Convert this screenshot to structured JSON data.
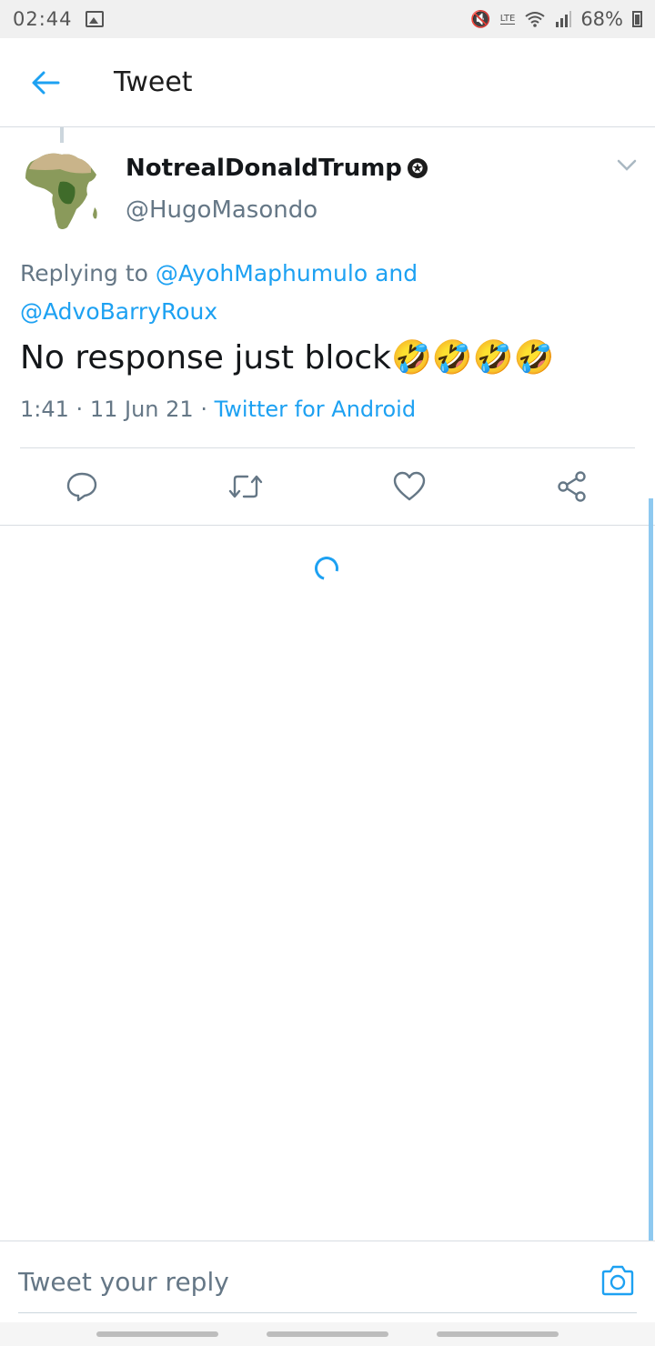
{
  "status_bar": {
    "time": "02:44",
    "battery": "68%",
    "network_label": "LTE"
  },
  "app_bar": {
    "title": "Tweet"
  },
  "tweet": {
    "display_name": "NotrealDonaldTrump",
    "handle": "@HugoMasondo",
    "replying_prefix": "Replying to",
    "mention_1": "@AyohMaphumulo",
    "conjunction": "and",
    "mention_2": "@AdvoBarryRoux",
    "text": "No response just block🤣🤣🤣🤣",
    "time": "1:41",
    "date": "11 Jun 21",
    "separator": "·",
    "source": "Twitter for Android"
  },
  "actions": [
    "reply-icon",
    "retweet-icon",
    "like-icon",
    "share-icon"
  ],
  "reply_bar": {
    "placeholder": "Tweet your reply"
  },
  "colors": {
    "accent": "#1da1f2",
    "secondary_text": "#657786",
    "divider": "#d8dde2"
  }
}
